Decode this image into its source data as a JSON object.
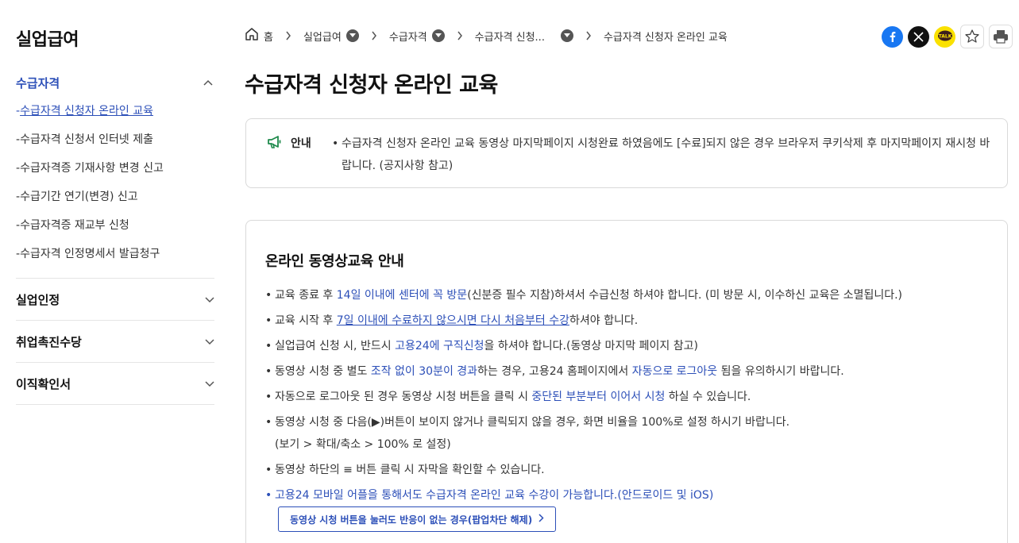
{
  "sidebar": {
    "title": "실업급여",
    "active_menu": "수급자격",
    "sub_items": [
      {
        "prefix": "-",
        "label": "수급자격 신청자 온라인 교육",
        "current": true
      },
      {
        "prefix": "-",
        "label": "수급자격 신청서 인터넷 제출"
      },
      {
        "prefix": "-",
        "label": "수급자격증 기재사항 변경 신고"
      },
      {
        "prefix": "-",
        "label": "수급기간 연기(변경) 신고"
      },
      {
        "prefix": "-",
        "label": "수급자격증 재교부 신청"
      },
      {
        "prefix": "-",
        "label": "수급자격 인정명세서 발급청구"
      }
    ],
    "groups": [
      "실업인정",
      "취업촉진수당",
      "이직확인서"
    ]
  },
  "breadcrumb": {
    "home": "홈",
    "items": [
      "실업급여",
      "수급자격",
      "수급자격 신청..."
    ],
    "current": "수급자격 신청자 온라인 교육"
  },
  "share": {
    "icons": [
      "facebook-icon",
      "x-icon",
      "kakaotalk-icon",
      "star-icon",
      "print-icon"
    ],
    "kakao_label": "TALK",
    "colors": {
      "facebook": "#1877f2",
      "x": "#111111",
      "kakao": "#fae100"
    }
  },
  "page_title": "수급자격 신청자 온라인 교육",
  "notice": {
    "label": "안내",
    "bullet": "•",
    "text": "수급자격 신청자 온라인 교육 동영상 마지막페이지 시청완료 하였음에도 [수료]되지 않은 경우 브라우저 쿠키삭제 후 마지막페이지 재시청 바랍니다. (공지사항 참고)"
  },
  "info": {
    "title": "온라인 동영상교육 안내",
    "items": [
      {
        "a": "교육 종료 후 ",
        "hl": "14일 이내에 센터에 꼭 방문",
        "b": "(신분증 필수 지참)하셔서 수급신청 하셔야 합니다. (미 방문 시, 이수하신 교육은 소멸됩니다.)"
      },
      {
        "a": "교육 시작 후 ",
        "hl": "7일 이내에 수료하지 않으시면 다시 처음부터 수강",
        "b": "하셔야 합니다."
      },
      {
        "a": "실업급여 신청 시, 반드시 ",
        "hl": "고용24에 구직신청",
        "b": "을 하셔야 합니다.(동영상 마지막 페이지 참고)"
      },
      {
        "a": "동영상 시청 중 별도 ",
        "hl": "조작 없이 30분이 경과",
        "b": "하는 경우, 고용24 홈페이지에서 ",
        "hl2": "자동으로 로그아웃",
        "c": " 됨을 유의하시기 바랍니다."
      },
      {
        "a": "자동으로 로그아웃 된 경우 동영상 시청 버튼을 클릭 시 ",
        "hl": "중단된 부분부터 이어서 시청",
        "b": " 하실 수 있습니다."
      },
      {
        "a": "동영상 시청 중 다음(▶)버튼이 보이지 않거나 클릭되지 않을 경우, 화면 비율을 100%로 설정 하시기 바랍니다.",
        "line2": "(보기 > 확대/축소 > 100% 로 설정)"
      },
      {
        "a": "동영상 하단의 ≡ 버튼 클릭 시 자막을 확인할 수 있습니다."
      },
      {
        "hl": "고용24 모바일 어플을 통해서도 수급자격 온라인 교육 수강이 가능합니다.(안드로이드 및 iOS)"
      }
    ],
    "popup_button": "동영상 시청 버튼을 눌러도 반응이 없는 경우(팝업차단 해제)"
  }
}
